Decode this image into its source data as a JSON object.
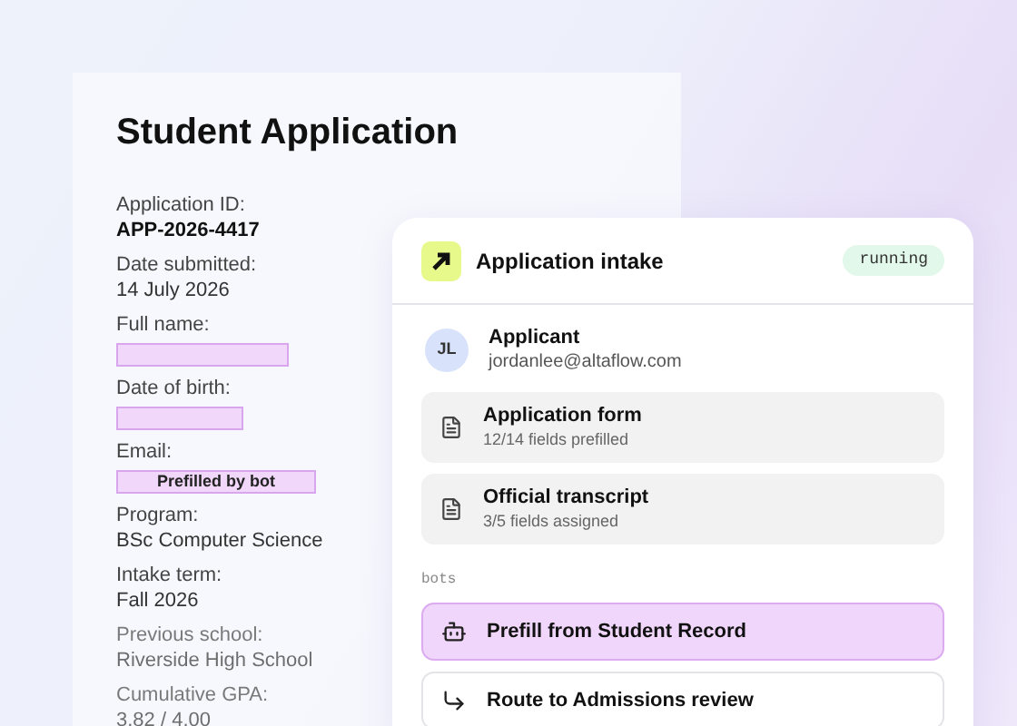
{
  "document": {
    "title": "Student Application",
    "fields": [
      {
        "label": "Application ID:",
        "kind": "strong",
        "value": "APP-2026-4417",
        "dimmed": false
      },
      {
        "label": "Date submitted:",
        "kind": "text",
        "value": "14 July 2026",
        "dimmed": false
      },
      {
        "label": "Full name:",
        "kind": "blank",
        "dimmed": false
      },
      {
        "label": "Date of birth:",
        "kind": "blank",
        "dimmed": false
      },
      {
        "label": "Email:",
        "kind": "prefilled",
        "value": "Prefilled by bot",
        "dimmed": false
      },
      {
        "label": "Program:",
        "kind": "text",
        "value": "BSc Computer Science",
        "dimmed": false
      },
      {
        "label": "Intake term:",
        "kind": "text",
        "value": "Fall 2026",
        "dimmed": false
      },
      {
        "label": "Previous school:",
        "kind": "text",
        "value": "Riverside High School",
        "dimmed": true
      },
      {
        "label": "Cumulative GPA:",
        "kind": "text",
        "value": "3.82 / 4.00",
        "dimmed": true
      }
    ]
  },
  "card": {
    "title": "Application intake",
    "status": "running",
    "applicant": {
      "initials": "JL",
      "role": "Applicant",
      "email": "jordanlee@altaflow.com"
    },
    "documents": [
      {
        "name": "Application form",
        "detail": "12/14 fields prefilled"
      },
      {
        "name": "Official transcript",
        "detail": "3/5 fields assigned"
      }
    ],
    "bots_label": "bots",
    "bots": [
      {
        "kind": "bot",
        "name": "Prefill from Student Record",
        "selected": true
      },
      {
        "kind": "route",
        "name": "Route to Admissions review",
        "selected": false
      }
    ]
  }
}
